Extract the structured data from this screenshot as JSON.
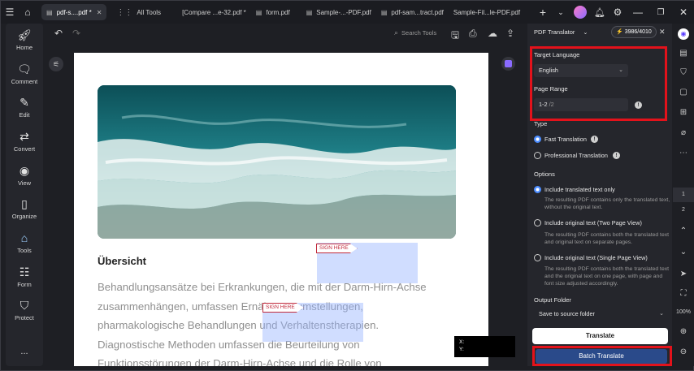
{
  "tabs": [
    {
      "label": "pdf-s....pdf *",
      "active": true
    },
    {
      "label": "All Tools",
      "active": false
    },
    {
      "label": "[Compare ...e-32.pdf *",
      "active": false
    },
    {
      "label": "form.pdf",
      "active": false
    },
    {
      "label": "Sample-...-PDF.pdf",
      "active": false
    },
    {
      "label": "pdf-sam...tract.pdf",
      "active": false
    },
    {
      "label": "Sample-Fil...le-PDF.pdf",
      "active": false
    }
  ],
  "sidebar": {
    "items": [
      {
        "label": "Home",
        "icon": "rocket-icon"
      },
      {
        "label": "Comment",
        "icon": "comment-icon"
      },
      {
        "label": "Edit",
        "icon": "edit-icon"
      },
      {
        "label": "Convert",
        "icon": "convert-icon"
      },
      {
        "label": "View",
        "icon": "eye-icon"
      },
      {
        "label": "Organize",
        "icon": "organize-icon"
      },
      {
        "label": "Tools",
        "icon": "tools-icon",
        "active": true
      },
      {
        "label": "Form",
        "icon": "form-icon"
      },
      {
        "label": "Protect",
        "icon": "shield-icon"
      }
    ],
    "more": "..."
  },
  "toolbar": {
    "search_label": "Search Tools"
  },
  "document": {
    "heading": "Übersicht",
    "body_lines": [
      "Behandlungsansätze bei Erkrankungen, die mit der Darm-Hirn-Achse",
      "zusammenhängen, umfassen Ernährungsumstellungen,",
      "pharmakologische Behandlungen und Verhaltenstherapien.",
      "Diagnostische Methoden umfassen die Beurteilung von",
      "Funktionsstörungen der Darm-Hirn-Achse und die Rolle von"
    ],
    "sign_here_1": "SIGN HERE",
    "sign_here_2": "SIGN HERE",
    "coord_x": "X:",
    "coord_y": "Y:"
  },
  "panel": {
    "title": "PDF Translator",
    "credits": "3986/4010",
    "target_language_label": "Target Language",
    "target_language_value": "English",
    "page_range_label": "Page Range",
    "page_range_value": "1-2",
    "page_range_total": "/2",
    "type_label": "Type",
    "type_options": [
      {
        "label": "Fast Translation",
        "selected": true
      },
      {
        "label": "Professional Translation",
        "selected": false
      }
    ],
    "options_label": "Options",
    "options": [
      {
        "label": "Include translated text only",
        "selected": true,
        "desc": "The resulting PDF contains only the translated text, without the original text."
      },
      {
        "label": "Include original text (Two Page View)",
        "selected": false,
        "desc": "The resulting PDF contains both the translated text and original text on separate pages."
      },
      {
        "label": "Include original text (Single Page View)",
        "selected": false,
        "desc": "The resulting PDF contains both the translated text and the original text on one page, with page and font size adjusted accordingly."
      }
    ],
    "output_folder_label": "Output Folder",
    "output_folder_value": "Save to source folder",
    "translate_button": "Translate",
    "batch_translate_button": "Batch Translate"
  },
  "rail": {
    "page_1": "1",
    "page_2": "2",
    "zoom": "100%"
  },
  "colors": {
    "accent": "#4c8dff",
    "highlight_red": "#e3121b",
    "batch_button": "#2a4a8a"
  }
}
